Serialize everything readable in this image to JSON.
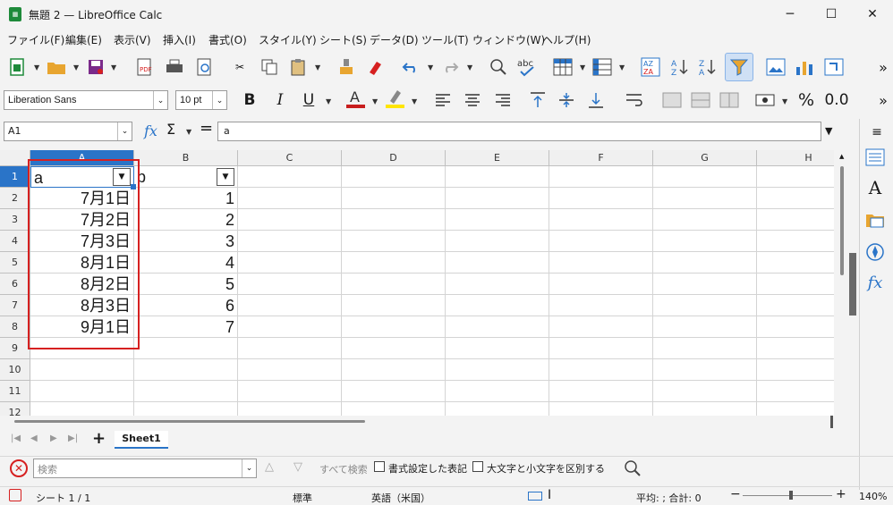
{
  "window": {
    "title": "無題 2 — LibreOffice Calc",
    "app_icon": "calc-icon",
    "minimize": "─",
    "maximize": "☐",
    "close": "✕"
  },
  "menu": [
    "ファイル(F)",
    "編集(E)",
    "表示(V)",
    "挿入(I)",
    "書式(O)",
    "スタイル(Y)",
    "シート(S)",
    "データ(D)",
    "ツール(T)",
    "ウィンドウ(W)",
    "ヘルプ(H)"
  ],
  "format": {
    "font": "Liberation Sans",
    "size": "10 pt",
    "bold": "B",
    "italic": "I",
    "underline": "U",
    "percent": "%",
    "decimal": "0.0"
  },
  "formula": {
    "cell_ref": "A1",
    "fx": "fx",
    "sum": "Σ",
    "equals": "=",
    "content": "a"
  },
  "columns": [
    "A",
    "B",
    "C",
    "D",
    "E",
    "F",
    "G",
    "H"
  ],
  "rows": [
    "1",
    "2",
    "3",
    "4",
    "5",
    "6",
    "7",
    "8",
    "9",
    "10",
    "11",
    "12"
  ],
  "cells": {
    "header": [
      "a",
      "b"
    ],
    "col_a": [
      "7月1日",
      "7月2日",
      "7月3日",
      "8月1日",
      "8月2日",
      "8月3日",
      "9月1日"
    ],
    "col_b": [
      "1",
      "2",
      "3",
      "4",
      "5",
      "6",
      "7"
    ]
  },
  "sheets": {
    "active": "Sheet1",
    "add": "+"
  },
  "find": {
    "placeholder": "検索",
    "find_all": "すべて検索",
    "formatted": "書式設定した表記",
    "match_case": "大文字と小文字を区別する"
  },
  "status": {
    "sheet": "シート 1 / 1",
    "style": "標準",
    "language": "英語（米国）",
    "summary": "平均: ; 合計: 0",
    "zoom": "140%"
  },
  "highlight_color": "#d62020"
}
